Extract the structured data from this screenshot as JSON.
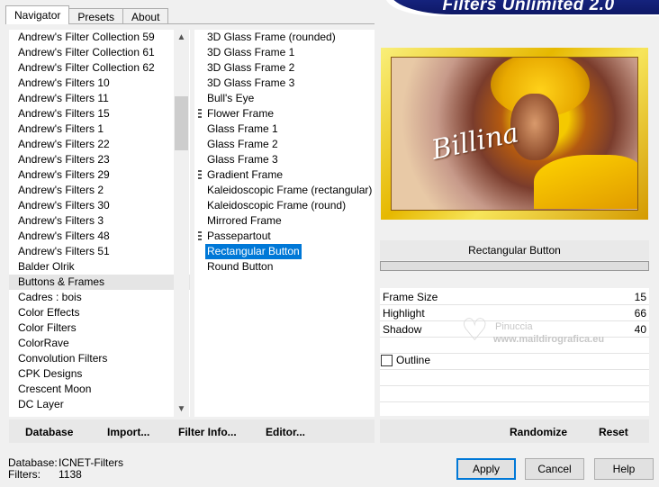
{
  "banner": {
    "title": "Filters Unlimited 2.0"
  },
  "tabs": [
    {
      "label": "Navigator",
      "active": true
    },
    {
      "label": "Presets",
      "active": false
    },
    {
      "label": "About",
      "active": false
    }
  ],
  "categories": {
    "items": [
      "Andrew's Filter Collection 59",
      "Andrew's Filter Collection 61",
      "Andrew's Filter Collection 62",
      "Andrew's Filters 10",
      "Andrew's Filters 11",
      "Andrew's Filters 15",
      "Andrew's Filters 1",
      "Andrew's Filters 22",
      "Andrew's Filters 23",
      "Andrew's Filters 29",
      "Andrew's Filters 2",
      "Andrew's Filters 30",
      "Andrew's Filters 3",
      "Andrew's Filters 48",
      "Andrew's Filters 51",
      "Balder Olrik",
      "Buttons & Frames",
      "Cadres : bois",
      "Color Effects",
      "Color Filters",
      "ColorRave",
      "Convolution Filters",
      "CPK Designs",
      "Crescent Moon",
      "DC Layer"
    ],
    "selected": "Buttons & Frames"
  },
  "filters": {
    "items": [
      {
        "label": "3D Glass Frame (rounded)",
        "marked": false
      },
      {
        "label": "3D Glass Frame 1",
        "marked": false
      },
      {
        "label": "3D Glass Frame 2",
        "marked": false
      },
      {
        "label": "3D Glass Frame 3",
        "marked": false
      },
      {
        "label": "Bull's Eye",
        "marked": false
      },
      {
        "label": "Flower Frame",
        "marked": true
      },
      {
        "label": "Glass Frame 1",
        "marked": false
      },
      {
        "label": "Glass Frame 2",
        "marked": false
      },
      {
        "label": "Glass Frame 3",
        "marked": false
      },
      {
        "label": "Gradient Frame",
        "marked": true
      },
      {
        "label": "Kaleidoscopic Frame (rectangular)",
        "marked": false
      },
      {
        "label": "Kaleidoscopic Frame (round)",
        "marked": false
      },
      {
        "label": "Mirrored Frame",
        "marked": false
      },
      {
        "label": "Passepartout",
        "marked": true
      },
      {
        "label": "Rectangular Button",
        "marked": false
      },
      {
        "label": "Round Button",
        "marked": false
      }
    ],
    "selected": "Rectangular Button"
  },
  "preview": {
    "signature": "Billina"
  },
  "params": {
    "filter_name": "Rectangular Button",
    "rows": [
      {
        "label": "Frame Size",
        "value": "15"
      },
      {
        "label": "Highlight",
        "value": "66"
      },
      {
        "label": "Shadow",
        "value": "40"
      }
    ],
    "outline_label": "Outline",
    "outline_checked": false
  },
  "watermark": {
    "line1": "Pinuccia",
    "line2": "www.maildirografica.eu"
  },
  "left_actions": {
    "database": "Database",
    "import": "Import...",
    "filter_info": "Filter Info...",
    "editor": "Editor..."
  },
  "right_actions": {
    "randomize": "Randomize",
    "reset": "Reset"
  },
  "footer": {
    "database_label": "Database:",
    "database_value": "ICNET-Filters",
    "filters_label": "Filters:",
    "filters_value": "1138"
  },
  "buttons": {
    "apply": "Apply",
    "cancel": "Cancel",
    "help": "Help"
  },
  "colors": {
    "selection": "#0078d7",
    "banner": "#1a2a8c"
  }
}
